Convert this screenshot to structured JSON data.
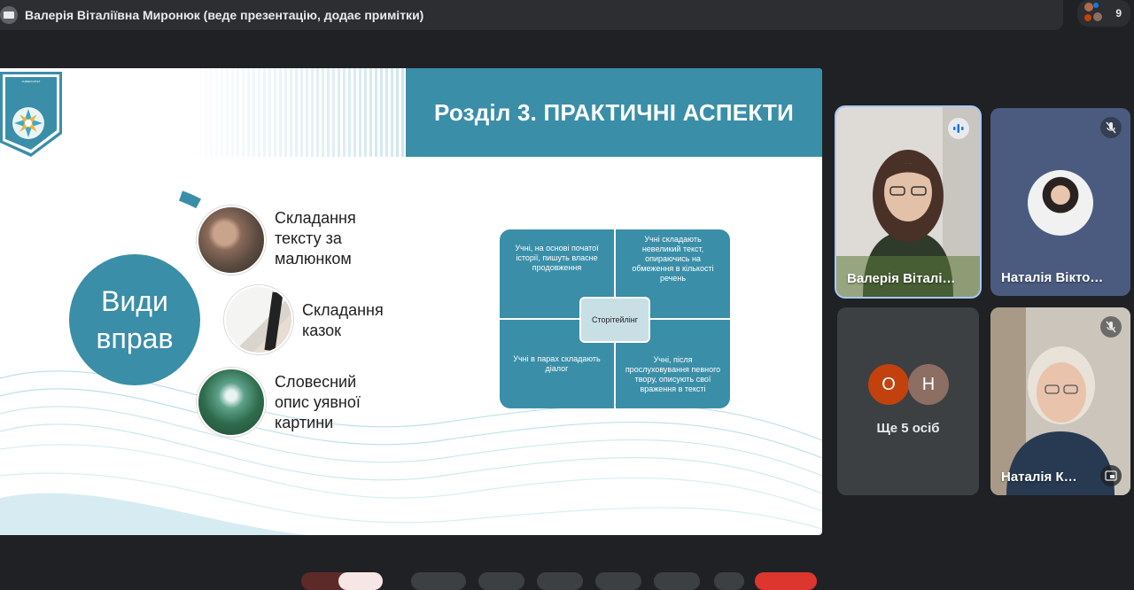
{
  "topbar": {
    "presenter_title": "Валерія Віталіївна Миронюк (веде презентацію, додає примітки)",
    "participants_count": "9"
  },
  "slide": {
    "heading": "Розділ 3. ПРАКТИЧНІ АСПЕКТИ",
    "badge_text": "НАЦІОНАЛЬНИЙ ТЕХНІЧНИЙ УНІВЕРСИТЕТ ІМЕНІ ЮРІЯ КОНДРАТЮКА",
    "circle_line1": "Види",
    "circle_line2": "вправ",
    "items": [
      {
        "label": "Складання\nтексту за\nмалюнком"
      },
      {
        "label": "Складання\nказок"
      },
      {
        "label": "Словесний\nопис уявної\nкартини"
      }
    ],
    "matrix": {
      "center": "Сторітейлінг",
      "cells": [
        "Учні, на основі початої історії, пишуть власне продовження",
        "Учні складають невеликий текст, опираючись на обмеження в кількості речень",
        "Учні в парах складають діалог",
        "Учні, після прослуховування певного твору, описують свої враження в тексті"
      ]
    }
  },
  "participants": {
    "tile1_name": "Валерія Віталі…",
    "tile2_name": "Наталія Вікто…",
    "tile4_name": "Наталія К…",
    "more_initials": [
      "О",
      "Н"
    ],
    "more_label": "Ще 5 осіб"
  },
  "colors": {
    "accent": "#3a8ea8",
    "bg": "#202124",
    "avatar_o": "#c2410c",
    "avatar_n": "#8d6e63"
  }
}
